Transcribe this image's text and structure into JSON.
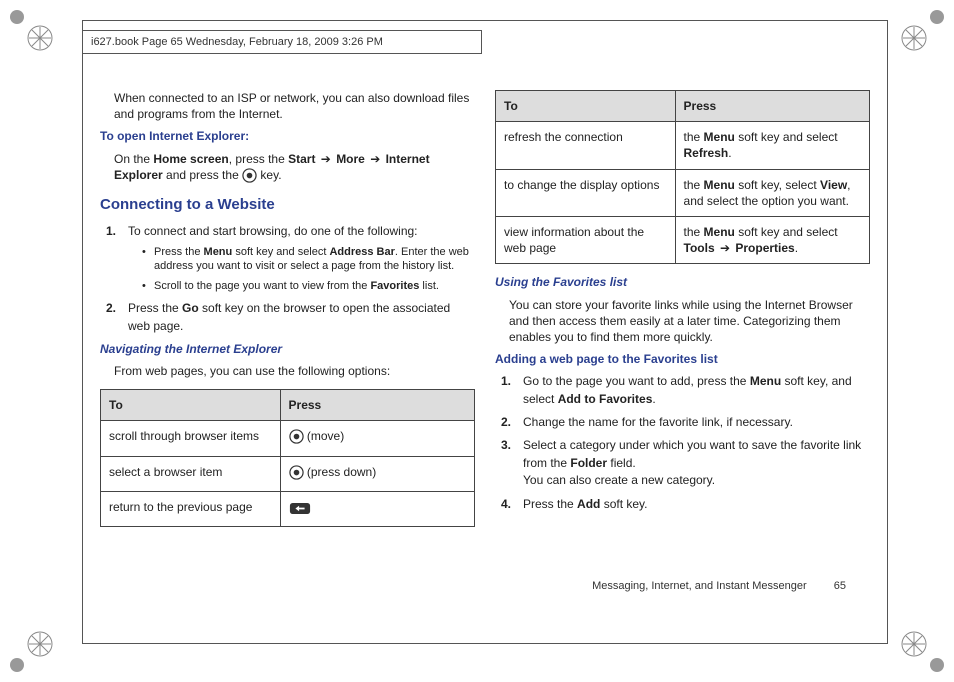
{
  "header_running": "i627.book  Page 65  Wednesday, February 18, 2009  3:26 PM",
  "left": {
    "intro": "When connected to an ISP or network, you can also download files and programs from the Internet.",
    "open_ie_heading": "To open Internet Explorer:",
    "open_ie_body": {
      "pre": "On the ",
      "b1": "Home screen",
      "mid1": ", press the ",
      "b2": "Start",
      "arr": " ➔ ",
      "b3": "More",
      "b4": "Internet Explorer",
      "mid2": " and press the ",
      "tail": " key."
    },
    "connect_heading": "Connecting to a Website",
    "step1": "To connect and start browsing, do one of the following:",
    "step1_a": {
      "pre": "Press the ",
      "b1": "Menu",
      "mid1": " soft key and select ",
      "b2": "Address Bar",
      "tail": ". Enter the web address you want to visit or select a page from the history list."
    },
    "step1_b": {
      "pre": "Scroll to the page you want to view from the ",
      "b1": "Favorites",
      "tail": " list."
    },
    "step2": {
      "pre": "Press the ",
      "b1": "Go",
      "tail": " soft key on the browser to open the associated web page."
    },
    "nav_heading": "Navigating the Internet Explorer",
    "nav_body": "From web pages, you can use the following options:",
    "table": {
      "h1": "To",
      "h2": "Press",
      "r1c1": "scroll through browser items",
      "r1c2": " (move)",
      "r2c1": "select a browser item",
      "r2c2": " (press down)",
      "r3c1": "return to the previous page",
      "r3c2": ""
    }
  },
  "right": {
    "table": {
      "h1": "To",
      "h2": "Press",
      "r1c1": "refresh the connection",
      "r1c2": {
        "pre": "the ",
        "b1": "Menu",
        "mid": " soft key and select ",
        "b2": "Refresh",
        "tail": "."
      },
      "r2c1": "to change the display options",
      "r2c2": {
        "pre": "the ",
        "b1": "Menu",
        "mid1": " soft key, select ",
        "b2": "View",
        "tail": ", and select the option you want."
      },
      "r3c1": "view information about the web page",
      "r3c2": {
        "pre": "the ",
        "b1": "Menu",
        "mid1": " soft key and select ",
        "b2": "Tools",
        "arr": " ➔ ",
        "b3": "Properties",
        "tail": "."
      }
    },
    "fav_heading": "Using the Favorites list",
    "fav_body": "You can store your favorite links while using the Internet Browser and then access them easily at a later time. Categorizing them enables you to find them more quickly.",
    "add_heading": "Adding a web page to the Favorites list",
    "s1": {
      "pre": "Go to the page you want to add, press the ",
      "b1": "Menu",
      "mid": " soft key, and select ",
      "b2": "Add to Favorites",
      "tail": "."
    },
    "s2": "Change the name for the favorite link, if necessary.",
    "s3": {
      "pre": "Select a category under which you want to save the favorite link from the ",
      "b1": "Folder",
      "tail": " field."
    },
    "s3b": "You can also create a new category.",
    "s4": {
      "pre": "Press the ",
      "b1": "Add",
      "tail": " soft key."
    }
  },
  "labels": {
    "n1": "1.",
    "n2": "2.",
    "n3": "3.",
    "n4": "4."
  },
  "footer": {
    "section": "Messaging, Internet, and Instant Messenger",
    "page": "65"
  }
}
